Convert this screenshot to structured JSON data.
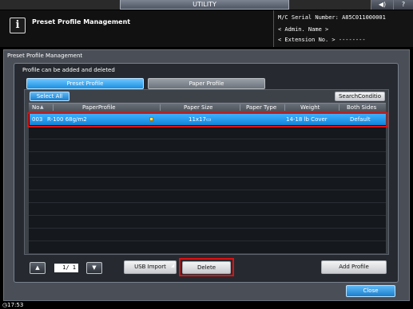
{
  "top_bar": {
    "utility_label": "UTILITY",
    "speaker_glyph": "◀)",
    "question_glyph": "?"
  },
  "header": {
    "info_glyph": "i",
    "title": "Preset Profile Management",
    "serial_line": "M/C Serial Number: A85C011000001",
    "admin_line": "< Admin. Name >",
    "extension_line": "< Extension No. > --------"
  },
  "panel": {
    "title": "Preset Profile Management",
    "message": "Profile can be added and deleted"
  },
  "tabs": [
    {
      "label": "Preset Profile",
      "active": true
    },
    {
      "label": "Paper Profile",
      "active": false
    }
  ],
  "buttons": {
    "select_all": "Select All",
    "search_condition": "SearchConditio",
    "usb_import": "USB Import",
    "delete": "Delete",
    "add_profile": "Add Profile",
    "close": "Close"
  },
  "table": {
    "columns": {
      "no": "No",
      "paper_profile": "PaperProfile",
      "paper_size": "Paper Size",
      "paper_type": "Paper Type",
      "weight": "Weight",
      "both_sides": "Both Sides"
    },
    "sort_indicator": "▲",
    "rows": [
      {
        "no": "003",
        "paper_profile": "R-100  68g/m2",
        "paper_size": "11x17▭",
        "paper_type": "",
        "weight": "14-18 lb Cover",
        "both_sides": "Default",
        "selected": true
      }
    ]
  },
  "pagination": {
    "prev_glyph": "▲",
    "next_glyph": "▼",
    "page_text": "1/  1"
  },
  "status": {
    "clock": "17:53"
  },
  "colors": {
    "selection_blue": "#1a8fe3",
    "highlight_red": "#e01010"
  }
}
